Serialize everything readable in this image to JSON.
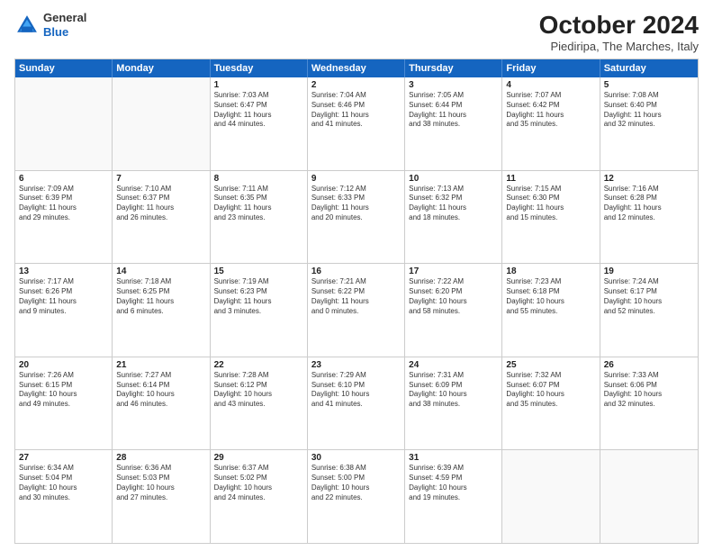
{
  "logo": {
    "general": "General",
    "blue": "Blue"
  },
  "header": {
    "month": "October 2024",
    "location": "Piediripa, The Marches, Italy"
  },
  "days": [
    "Sunday",
    "Monday",
    "Tuesday",
    "Wednesday",
    "Thursday",
    "Friday",
    "Saturday"
  ],
  "weeks": [
    [
      {
        "day": "",
        "lines": []
      },
      {
        "day": "",
        "lines": []
      },
      {
        "day": "1",
        "lines": [
          "Sunrise: 7:03 AM",
          "Sunset: 6:47 PM",
          "Daylight: 11 hours",
          "and 44 minutes."
        ]
      },
      {
        "day": "2",
        "lines": [
          "Sunrise: 7:04 AM",
          "Sunset: 6:46 PM",
          "Daylight: 11 hours",
          "and 41 minutes."
        ]
      },
      {
        "day": "3",
        "lines": [
          "Sunrise: 7:05 AM",
          "Sunset: 6:44 PM",
          "Daylight: 11 hours",
          "and 38 minutes."
        ]
      },
      {
        "day": "4",
        "lines": [
          "Sunrise: 7:07 AM",
          "Sunset: 6:42 PM",
          "Daylight: 11 hours",
          "and 35 minutes."
        ]
      },
      {
        "day": "5",
        "lines": [
          "Sunrise: 7:08 AM",
          "Sunset: 6:40 PM",
          "Daylight: 11 hours",
          "and 32 minutes."
        ]
      }
    ],
    [
      {
        "day": "6",
        "lines": [
          "Sunrise: 7:09 AM",
          "Sunset: 6:39 PM",
          "Daylight: 11 hours",
          "and 29 minutes."
        ]
      },
      {
        "day": "7",
        "lines": [
          "Sunrise: 7:10 AM",
          "Sunset: 6:37 PM",
          "Daylight: 11 hours",
          "and 26 minutes."
        ]
      },
      {
        "day": "8",
        "lines": [
          "Sunrise: 7:11 AM",
          "Sunset: 6:35 PM",
          "Daylight: 11 hours",
          "and 23 minutes."
        ]
      },
      {
        "day": "9",
        "lines": [
          "Sunrise: 7:12 AM",
          "Sunset: 6:33 PM",
          "Daylight: 11 hours",
          "and 20 minutes."
        ]
      },
      {
        "day": "10",
        "lines": [
          "Sunrise: 7:13 AM",
          "Sunset: 6:32 PM",
          "Daylight: 11 hours",
          "and 18 minutes."
        ]
      },
      {
        "day": "11",
        "lines": [
          "Sunrise: 7:15 AM",
          "Sunset: 6:30 PM",
          "Daylight: 11 hours",
          "and 15 minutes."
        ]
      },
      {
        "day": "12",
        "lines": [
          "Sunrise: 7:16 AM",
          "Sunset: 6:28 PM",
          "Daylight: 11 hours",
          "and 12 minutes."
        ]
      }
    ],
    [
      {
        "day": "13",
        "lines": [
          "Sunrise: 7:17 AM",
          "Sunset: 6:26 PM",
          "Daylight: 11 hours",
          "and 9 minutes."
        ]
      },
      {
        "day": "14",
        "lines": [
          "Sunrise: 7:18 AM",
          "Sunset: 6:25 PM",
          "Daylight: 11 hours",
          "and 6 minutes."
        ]
      },
      {
        "day": "15",
        "lines": [
          "Sunrise: 7:19 AM",
          "Sunset: 6:23 PM",
          "Daylight: 11 hours",
          "and 3 minutes."
        ]
      },
      {
        "day": "16",
        "lines": [
          "Sunrise: 7:21 AM",
          "Sunset: 6:22 PM",
          "Daylight: 11 hours",
          "and 0 minutes."
        ]
      },
      {
        "day": "17",
        "lines": [
          "Sunrise: 7:22 AM",
          "Sunset: 6:20 PM",
          "Daylight: 10 hours",
          "and 58 minutes."
        ]
      },
      {
        "day": "18",
        "lines": [
          "Sunrise: 7:23 AM",
          "Sunset: 6:18 PM",
          "Daylight: 10 hours",
          "and 55 minutes."
        ]
      },
      {
        "day": "19",
        "lines": [
          "Sunrise: 7:24 AM",
          "Sunset: 6:17 PM",
          "Daylight: 10 hours",
          "and 52 minutes."
        ]
      }
    ],
    [
      {
        "day": "20",
        "lines": [
          "Sunrise: 7:26 AM",
          "Sunset: 6:15 PM",
          "Daylight: 10 hours",
          "and 49 minutes."
        ]
      },
      {
        "day": "21",
        "lines": [
          "Sunrise: 7:27 AM",
          "Sunset: 6:14 PM",
          "Daylight: 10 hours",
          "and 46 minutes."
        ]
      },
      {
        "day": "22",
        "lines": [
          "Sunrise: 7:28 AM",
          "Sunset: 6:12 PM",
          "Daylight: 10 hours",
          "and 43 minutes."
        ]
      },
      {
        "day": "23",
        "lines": [
          "Sunrise: 7:29 AM",
          "Sunset: 6:10 PM",
          "Daylight: 10 hours",
          "and 41 minutes."
        ]
      },
      {
        "day": "24",
        "lines": [
          "Sunrise: 7:31 AM",
          "Sunset: 6:09 PM",
          "Daylight: 10 hours",
          "and 38 minutes."
        ]
      },
      {
        "day": "25",
        "lines": [
          "Sunrise: 7:32 AM",
          "Sunset: 6:07 PM",
          "Daylight: 10 hours",
          "and 35 minutes."
        ]
      },
      {
        "day": "26",
        "lines": [
          "Sunrise: 7:33 AM",
          "Sunset: 6:06 PM",
          "Daylight: 10 hours",
          "and 32 minutes."
        ]
      }
    ],
    [
      {
        "day": "27",
        "lines": [
          "Sunrise: 6:34 AM",
          "Sunset: 5:04 PM",
          "Daylight: 10 hours",
          "and 30 minutes."
        ]
      },
      {
        "day": "28",
        "lines": [
          "Sunrise: 6:36 AM",
          "Sunset: 5:03 PM",
          "Daylight: 10 hours",
          "and 27 minutes."
        ]
      },
      {
        "day": "29",
        "lines": [
          "Sunrise: 6:37 AM",
          "Sunset: 5:02 PM",
          "Daylight: 10 hours",
          "and 24 minutes."
        ]
      },
      {
        "day": "30",
        "lines": [
          "Sunrise: 6:38 AM",
          "Sunset: 5:00 PM",
          "Daylight: 10 hours",
          "and 22 minutes."
        ]
      },
      {
        "day": "31",
        "lines": [
          "Sunrise: 6:39 AM",
          "Sunset: 4:59 PM",
          "Daylight: 10 hours",
          "and 19 minutes."
        ]
      },
      {
        "day": "",
        "lines": []
      },
      {
        "day": "",
        "lines": []
      }
    ]
  ]
}
